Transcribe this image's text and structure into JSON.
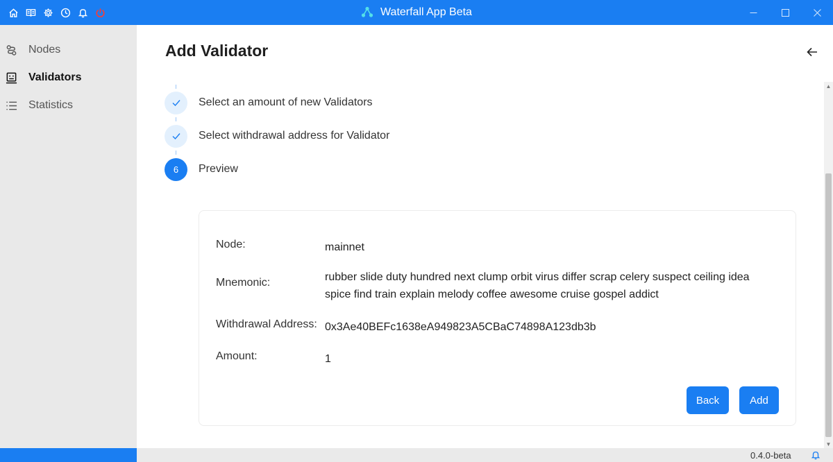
{
  "window": {
    "title": "Waterfall App Beta",
    "toolbar_icons": [
      "home-icon",
      "book-icon",
      "gear-icon",
      "clock-icon",
      "bell-icon",
      "power-icon"
    ],
    "accent_color": "#1a7ef2",
    "power_color": "#e53935"
  },
  "sidebar": {
    "items": [
      {
        "label": "Nodes",
        "icon": "nodes-icon",
        "active": false
      },
      {
        "label": "Validators",
        "icon": "validators-icon",
        "active": true
      },
      {
        "label": "Statistics",
        "icon": "list-icon",
        "active": false
      }
    ]
  },
  "main": {
    "title": "Add Validator",
    "steps": [
      {
        "label": "Select an amount of new Validators",
        "status": "done"
      },
      {
        "label": "Select withdrawal address for Validator",
        "status": "done"
      },
      {
        "label": "Preview",
        "status": "current",
        "number": "6"
      }
    ],
    "preview": {
      "node_label": "Node:",
      "node_value": "mainnet",
      "mnemonic_label": "Mnemonic:",
      "mnemonic_value": "rubber slide duty hundred next clump orbit virus differ scrap celery suspect ceiling idea spice find train explain melody coffee awesome cruise gospel addict",
      "withdrawal_label": "Withdrawal Address:",
      "withdrawal_value": "0x3Ae40BEFc1638eA949823A5CBaC74898A123db3b",
      "amount_label": "Amount:",
      "amount_value": "1"
    },
    "buttons": {
      "back": "Back",
      "add": "Add"
    }
  },
  "status": {
    "version": "0.4.0-beta"
  }
}
